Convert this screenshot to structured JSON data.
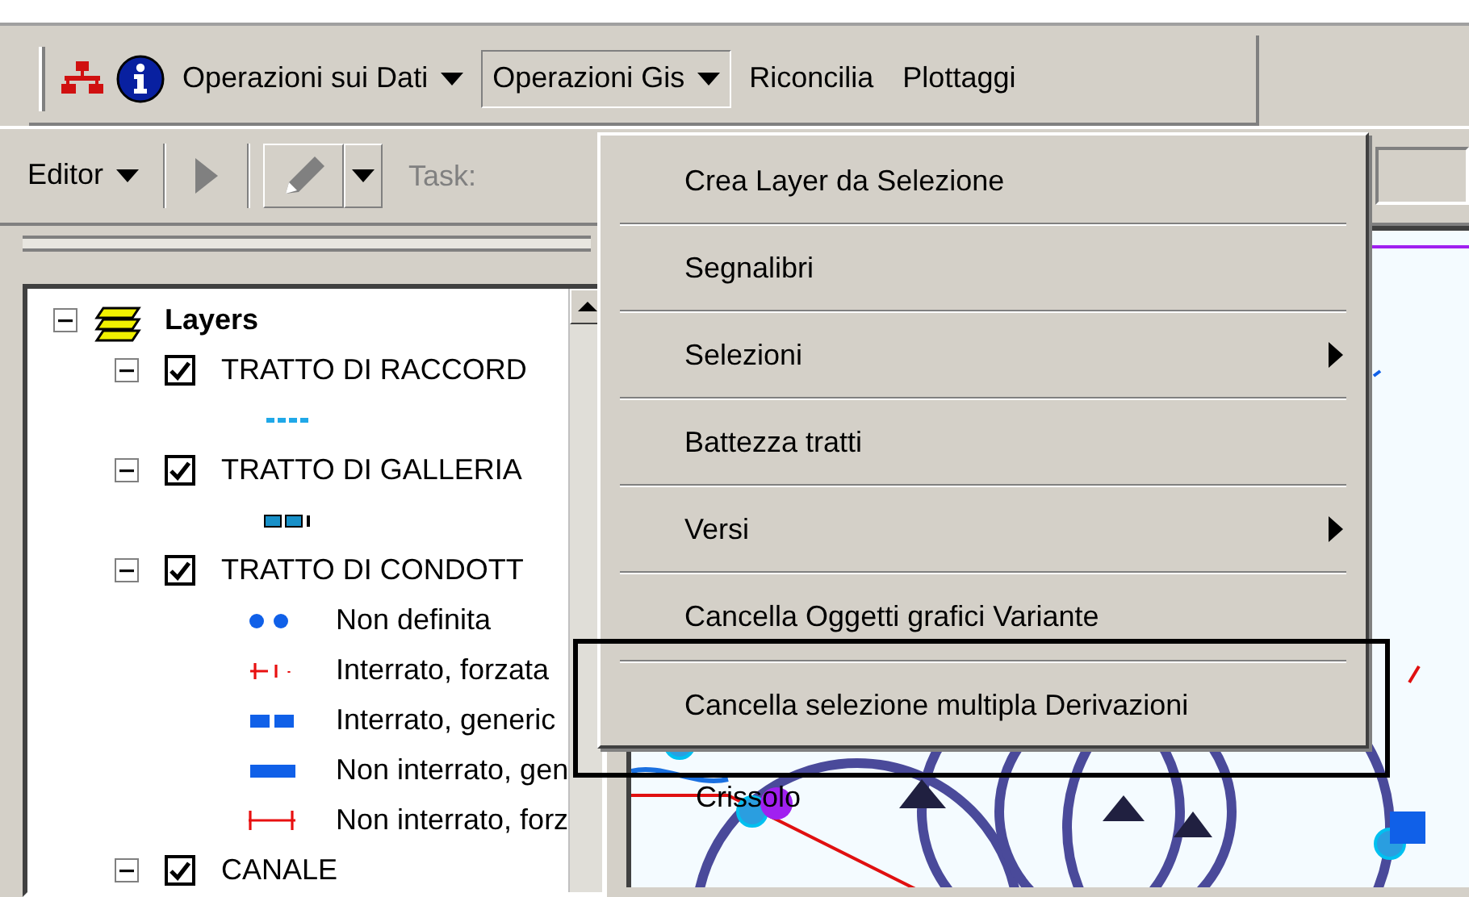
{
  "menu_bar": [
    {
      "label": "Operazioni sui Dati",
      "selected": false
    },
    {
      "label": "Operazioni Gis",
      "selected": true
    },
    {
      "label": "Riconcilia",
      "selected": false
    },
    {
      "label": "Plottaggi",
      "selected": false
    }
  ],
  "editor_toolbar": {
    "editor_label": "Editor",
    "task_label": "Task:"
  },
  "layers_tree": {
    "label": "Layers",
    "expanded": true,
    "children": [
      {
        "label": "TRATTO DI RACCORD",
        "checked": true,
        "expanded": true,
        "children": [
          {
            "kind": "short-dashes",
            "color": "#20a8e8"
          }
        ]
      },
      {
        "label": "TRATTO DI GALLERIA",
        "checked": true,
        "expanded": true,
        "children": [
          {
            "kind": "blocks",
            "color": "#1890c8"
          }
        ]
      },
      {
        "label": "TRATTO DI CONDOTT",
        "checked": true,
        "expanded": true,
        "children": [
          {
            "kind": "dots",
            "color": "#1060e8",
            "label": "Non definita"
          },
          {
            "kind": "tick-dash",
            "color": "#e81010",
            "label": "Interrato, forzata"
          },
          {
            "kind": "squares",
            "color": "#1060e8",
            "label": "Interrato, generic"
          },
          {
            "kind": "bar",
            "color": "#1060e8",
            "label": "Non interrato, gen"
          },
          {
            "kind": "tick-line",
            "color": "#e81010",
            "label": "Non interrato, forz"
          }
        ]
      },
      {
        "label": "CANALE",
        "checked": true,
        "expanded": true
      }
    ]
  },
  "open_menu": {
    "items": [
      {
        "label": "Crea Layer da Selezione",
        "submenu": false,
        "outlined": false
      },
      {
        "label": "Segnalibri",
        "submenu": false,
        "outlined": false
      },
      {
        "label": "Selezioni",
        "submenu": true,
        "outlined": false
      },
      {
        "label": "Battezza tratti",
        "submenu": false,
        "outlined": false
      },
      {
        "label": "Versi",
        "submenu": true,
        "outlined": false
      },
      {
        "label": "Cancella Oggetti grafici Variante",
        "submenu": false,
        "outlined": false
      },
      {
        "label": "Cancella selezione multipla Derivazioni",
        "submenu": false,
        "outlined": true
      }
    ]
  },
  "map": {
    "labels": [
      "Crissolo"
    ]
  }
}
